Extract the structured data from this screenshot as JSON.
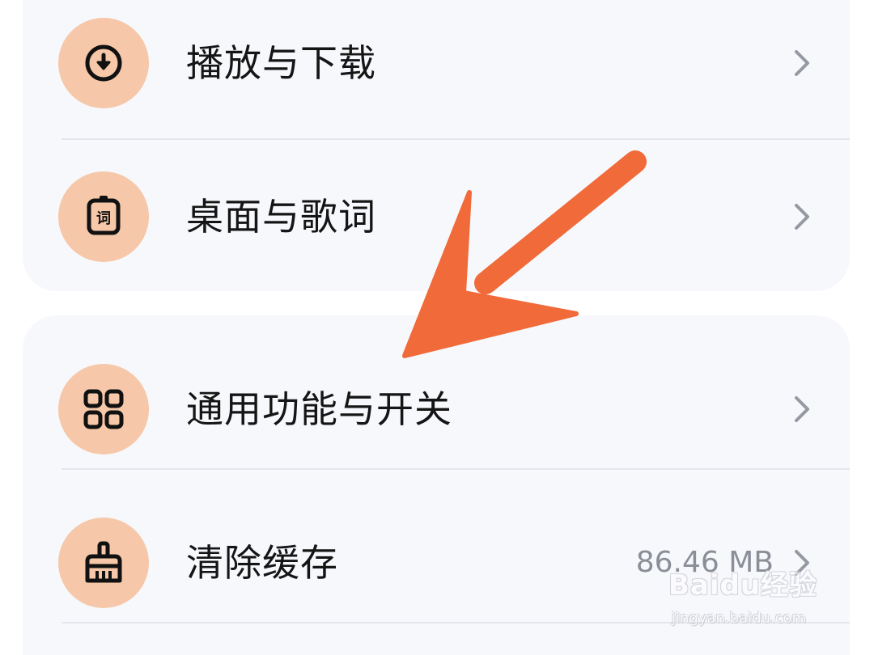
{
  "settings_group_1": {
    "items": [
      {
        "label": "播放与下载",
        "icon": "download-circle-icon"
      },
      {
        "label": "桌面与歌词",
        "icon": "lyrics-icon",
        "icon_text": "词"
      }
    ]
  },
  "settings_group_2": {
    "items": [
      {
        "label": "通用功能与开关",
        "icon": "grid-apps-icon"
      },
      {
        "label": "清除缓存",
        "icon": "broom-icon",
        "value": "86.46 MB"
      }
    ]
  },
  "colors": {
    "card_background": "#f7f8fc",
    "icon_background": "#f6c8a9",
    "annotation_arrow": "#f06a3a",
    "value_text": "#8a8e96"
  },
  "watermark": {
    "brand": "Baidu经验",
    "url": "jingyan.baidu.com"
  }
}
